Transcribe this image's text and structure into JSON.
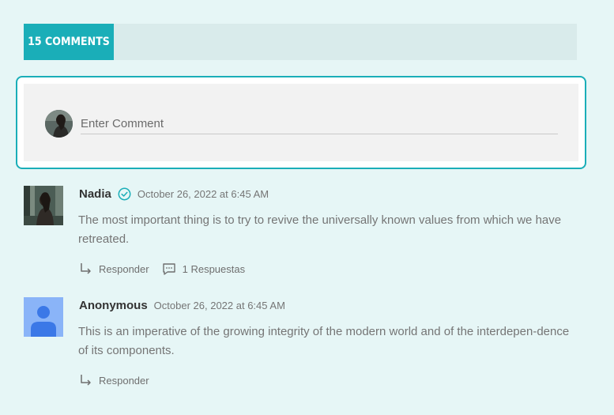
{
  "header": {
    "comments_count_label": "15 COMMENTS"
  },
  "composer": {
    "placeholder": "Enter Comment"
  },
  "comments": [
    {
      "author": "Nadia",
      "verified": true,
      "date": "October 26, 2022 at 6:45 AM",
      "text": "The most important thing is to try to revive the universally known values from which we have retreated.",
      "reply_label": "Responder",
      "replies_label": "1 Respuestas",
      "avatar": "user-photo"
    },
    {
      "author": "Anonymous",
      "verified": false,
      "date": "October 26, 2022 at 6:45 AM",
      "text": "This is an imperative of the growing integrity of the modern world and of the interdepen-dence of its components.",
      "reply_label": "Responder",
      "avatar": "default-user-icon"
    }
  ],
  "colors": {
    "accent": "#1aaeb8",
    "background": "#e6f6f6",
    "header_bar": "#d9ebeb",
    "composer_inner": "#f2f2f2",
    "default_avatar_bg": "#8ab4f8",
    "default_avatar_fg": "#3b78e7"
  },
  "icons": {
    "verified": "check-circle-icon",
    "reply": "reply-arrow-icon",
    "replies": "comment-bubble-icon"
  }
}
